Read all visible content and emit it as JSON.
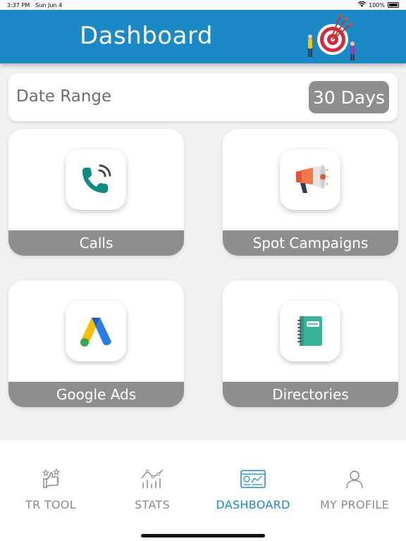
{
  "status_bar": {
    "time": "3:37 PM",
    "date": "Sun Jun 4",
    "battery": "100%"
  },
  "header": {
    "title": "Dashboard",
    "background_color": "#1b89c5"
  },
  "date_range": {
    "label": "Date Range",
    "value": "30 Days"
  },
  "tiles": [
    {
      "label": "Calls",
      "icon": "phone-icon"
    },
    {
      "label": "Spot Campaigns",
      "icon": "megaphone-icon"
    },
    {
      "label": "Google Ads",
      "icon": "google-ads-icon"
    },
    {
      "label": "Directories",
      "icon": "notebook-icon"
    }
  ],
  "bottom_nav": {
    "items": [
      {
        "label": "TR TOOL",
        "icon": "thumbs-up-icon",
        "active": false
      },
      {
        "label": "STATS",
        "icon": "stats-icon",
        "active": false
      },
      {
        "label": "DASHBOARD",
        "icon": "dashboard-icon",
        "active": true
      },
      {
        "label": "MY PROFILE",
        "icon": "profile-icon",
        "active": false
      }
    ],
    "active_color": "#1b89c5",
    "inactive_color": "#8a8a8a"
  }
}
